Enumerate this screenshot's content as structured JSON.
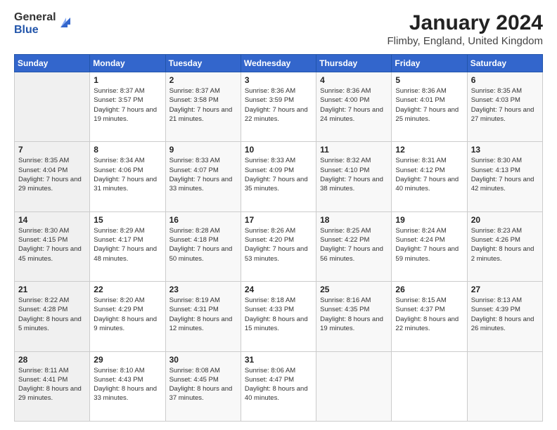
{
  "header": {
    "logo_general": "General",
    "logo_blue": "Blue",
    "title": "January 2024",
    "subtitle": "Flimby, England, United Kingdom"
  },
  "days_of_week": [
    "Sunday",
    "Monday",
    "Tuesday",
    "Wednesday",
    "Thursday",
    "Friday",
    "Saturday"
  ],
  "weeks": [
    [
      {
        "day": "",
        "sunrise": "",
        "sunset": "",
        "daylight": ""
      },
      {
        "day": "1",
        "sunrise": "Sunrise: 8:37 AM",
        "sunset": "Sunset: 3:57 PM",
        "daylight": "Daylight: 7 hours and 19 minutes."
      },
      {
        "day": "2",
        "sunrise": "Sunrise: 8:37 AM",
        "sunset": "Sunset: 3:58 PM",
        "daylight": "Daylight: 7 hours and 21 minutes."
      },
      {
        "day": "3",
        "sunrise": "Sunrise: 8:36 AM",
        "sunset": "Sunset: 3:59 PM",
        "daylight": "Daylight: 7 hours and 22 minutes."
      },
      {
        "day": "4",
        "sunrise": "Sunrise: 8:36 AM",
        "sunset": "Sunset: 4:00 PM",
        "daylight": "Daylight: 7 hours and 24 minutes."
      },
      {
        "day": "5",
        "sunrise": "Sunrise: 8:36 AM",
        "sunset": "Sunset: 4:01 PM",
        "daylight": "Daylight: 7 hours and 25 minutes."
      },
      {
        "day": "6",
        "sunrise": "Sunrise: 8:35 AM",
        "sunset": "Sunset: 4:03 PM",
        "daylight": "Daylight: 7 hours and 27 minutes."
      }
    ],
    [
      {
        "day": "7",
        "sunrise": "Sunrise: 8:35 AM",
        "sunset": "Sunset: 4:04 PM",
        "daylight": "Daylight: 7 hours and 29 minutes."
      },
      {
        "day": "8",
        "sunrise": "Sunrise: 8:34 AM",
        "sunset": "Sunset: 4:06 PM",
        "daylight": "Daylight: 7 hours and 31 minutes."
      },
      {
        "day": "9",
        "sunrise": "Sunrise: 8:33 AM",
        "sunset": "Sunset: 4:07 PM",
        "daylight": "Daylight: 7 hours and 33 minutes."
      },
      {
        "day": "10",
        "sunrise": "Sunrise: 8:33 AM",
        "sunset": "Sunset: 4:09 PM",
        "daylight": "Daylight: 7 hours and 35 minutes."
      },
      {
        "day": "11",
        "sunrise": "Sunrise: 8:32 AM",
        "sunset": "Sunset: 4:10 PM",
        "daylight": "Daylight: 7 hours and 38 minutes."
      },
      {
        "day": "12",
        "sunrise": "Sunrise: 8:31 AM",
        "sunset": "Sunset: 4:12 PM",
        "daylight": "Daylight: 7 hours and 40 minutes."
      },
      {
        "day": "13",
        "sunrise": "Sunrise: 8:30 AM",
        "sunset": "Sunset: 4:13 PM",
        "daylight": "Daylight: 7 hours and 42 minutes."
      }
    ],
    [
      {
        "day": "14",
        "sunrise": "Sunrise: 8:30 AM",
        "sunset": "Sunset: 4:15 PM",
        "daylight": "Daylight: 7 hours and 45 minutes."
      },
      {
        "day": "15",
        "sunrise": "Sunrise: 8:29 AM",
        "sunset": "Sunset: 4:17 PM",
        "daylight": "Daylight: 7 hours and 48 minutes."
      },
      {
        "day": "16",
        "sunrise": "Sunrise: 8:28 AM",
        "sunset": "Sunset: 4:18 PM",
        "daylight": "Daylight: 7 hours and 50 minutes."
      },
      {
        "day": "17",
        "sunrise": "Sunrise: 8:26 AM",
        "sunset": "Sunset: 4:20 PM",
        "daylight": "Daylight: 7 hours and 53 minutes."
      },
      {
        "day": "18",
        "sunrise": "Sunrise: 8:25 AM",
        "sunset": "Sunset: 4:22 PM",
        "daylight": "Daylight: 7 hours and 56 minutes."
      },
      {
        "day": "19",
        "sunrise": "Sunrise: 8:24 AM",
        "sunset": "Sunset: 4:24 PM",
        "daylight": "Daylight: 7 hours and 59 minutes."
      },
      {
        "day": "20",
        "sunrise": "Sunrise: 8:23 AM",
        "sunset": "Sunset: 4:26 PM",
        "daylight": "Daylight: 8 hours and 2 minutes."
      }
    ],
    [
      {
        "day": "21",
        "sunrise": "Sunrise: 8:22 AM",
        "sunset": "Sunset: 4:28 PM",
        "daylight": "Daylight: 8 hours and 5 minutes."
      },
      {
        "day": "22",
        "sunrise": "Sunrise: 8:20 AM",
        "sunset": "Sunset: 4:29 PM",
        "daylight": "Daylight: 8 hours and 9 minutes."
      },
      {
        "day": "23",
        "sunrise": "Sunrise: 8:19 AM",
        "sunset": "Sunset: 4:31 PM",
        "daylight": "Daylight: 8 hours and 12 minutes."
      },
      {
        "day": "24",
        "sunrise": "Sunrise: 8:18 AM",
        "sunset": "Sunset: 4:33 PM",
        "daylight": "Daylight: 8 hours and 15 minutes."
      },
      {
        "day": "25",
        "sunrise": "Sunrise: 8:16 AM",
        "sunset": "Sunset: 4:35 PM",
        "daylight": "Daylight: 8 hours and 19 minutes."
      },
      {
        "day": "26",
        "sunrise": "Sunrise: 8:15 AM",
        "sunset": "Sunset: 4:37 PM",
        "daylight": "Daylight: 8 hours and 22 minutes."
      },
      {
        "day": "27",
        "sunrise": "Sunrise: 8:13 AM",
        "sunset": "Sunset: 4:39 PM",
        "daylight": "Daylight: 8 hours and 26 minutes."
      }
    ],
    [
      {
        "day": "28",
        "sunrise": "Sunrise: 8:11 AM",
        "sunset": "Sunset: 4:41 PM",
        "daylight": "Daylight: 8 hours and 29 minutes."
      },
      {
        "day": "29",
        "sunrise": "Sunrise: 8:10 AM",
        "sunset": "Sunset: 4:43 PM",
        "daylight": "Daylight: 8 hours and 33 minutes."
      },
      {
        "day": "30",
        "sunrise": "Sunrise: 8:08 AM",
        "sunset": "Sunset: 4:45 PM",
        "daylight": "Daylight: 8 hours and 37 minutes."
      },
      {
        "day": "31",
        "sunrise": "Sunrise: 8:06 AM",
        "sunset": "Sunset: 4:47 PM",
        "daylight": "Daylight: 8 hours and 40 minutes."
      },
      {
        "day": "",
        "sunrise": "",
        "sunset": "",
        "daylight": ""
      },
      {
        "day": "",
        "sunrise": "",
        "sunset": "",
        "daylight": ""
      },
      {
        "day": "",
        "sunrise": "",
        "sunset": "",
        "daylight": ""
      }
    ]
  ]
}
